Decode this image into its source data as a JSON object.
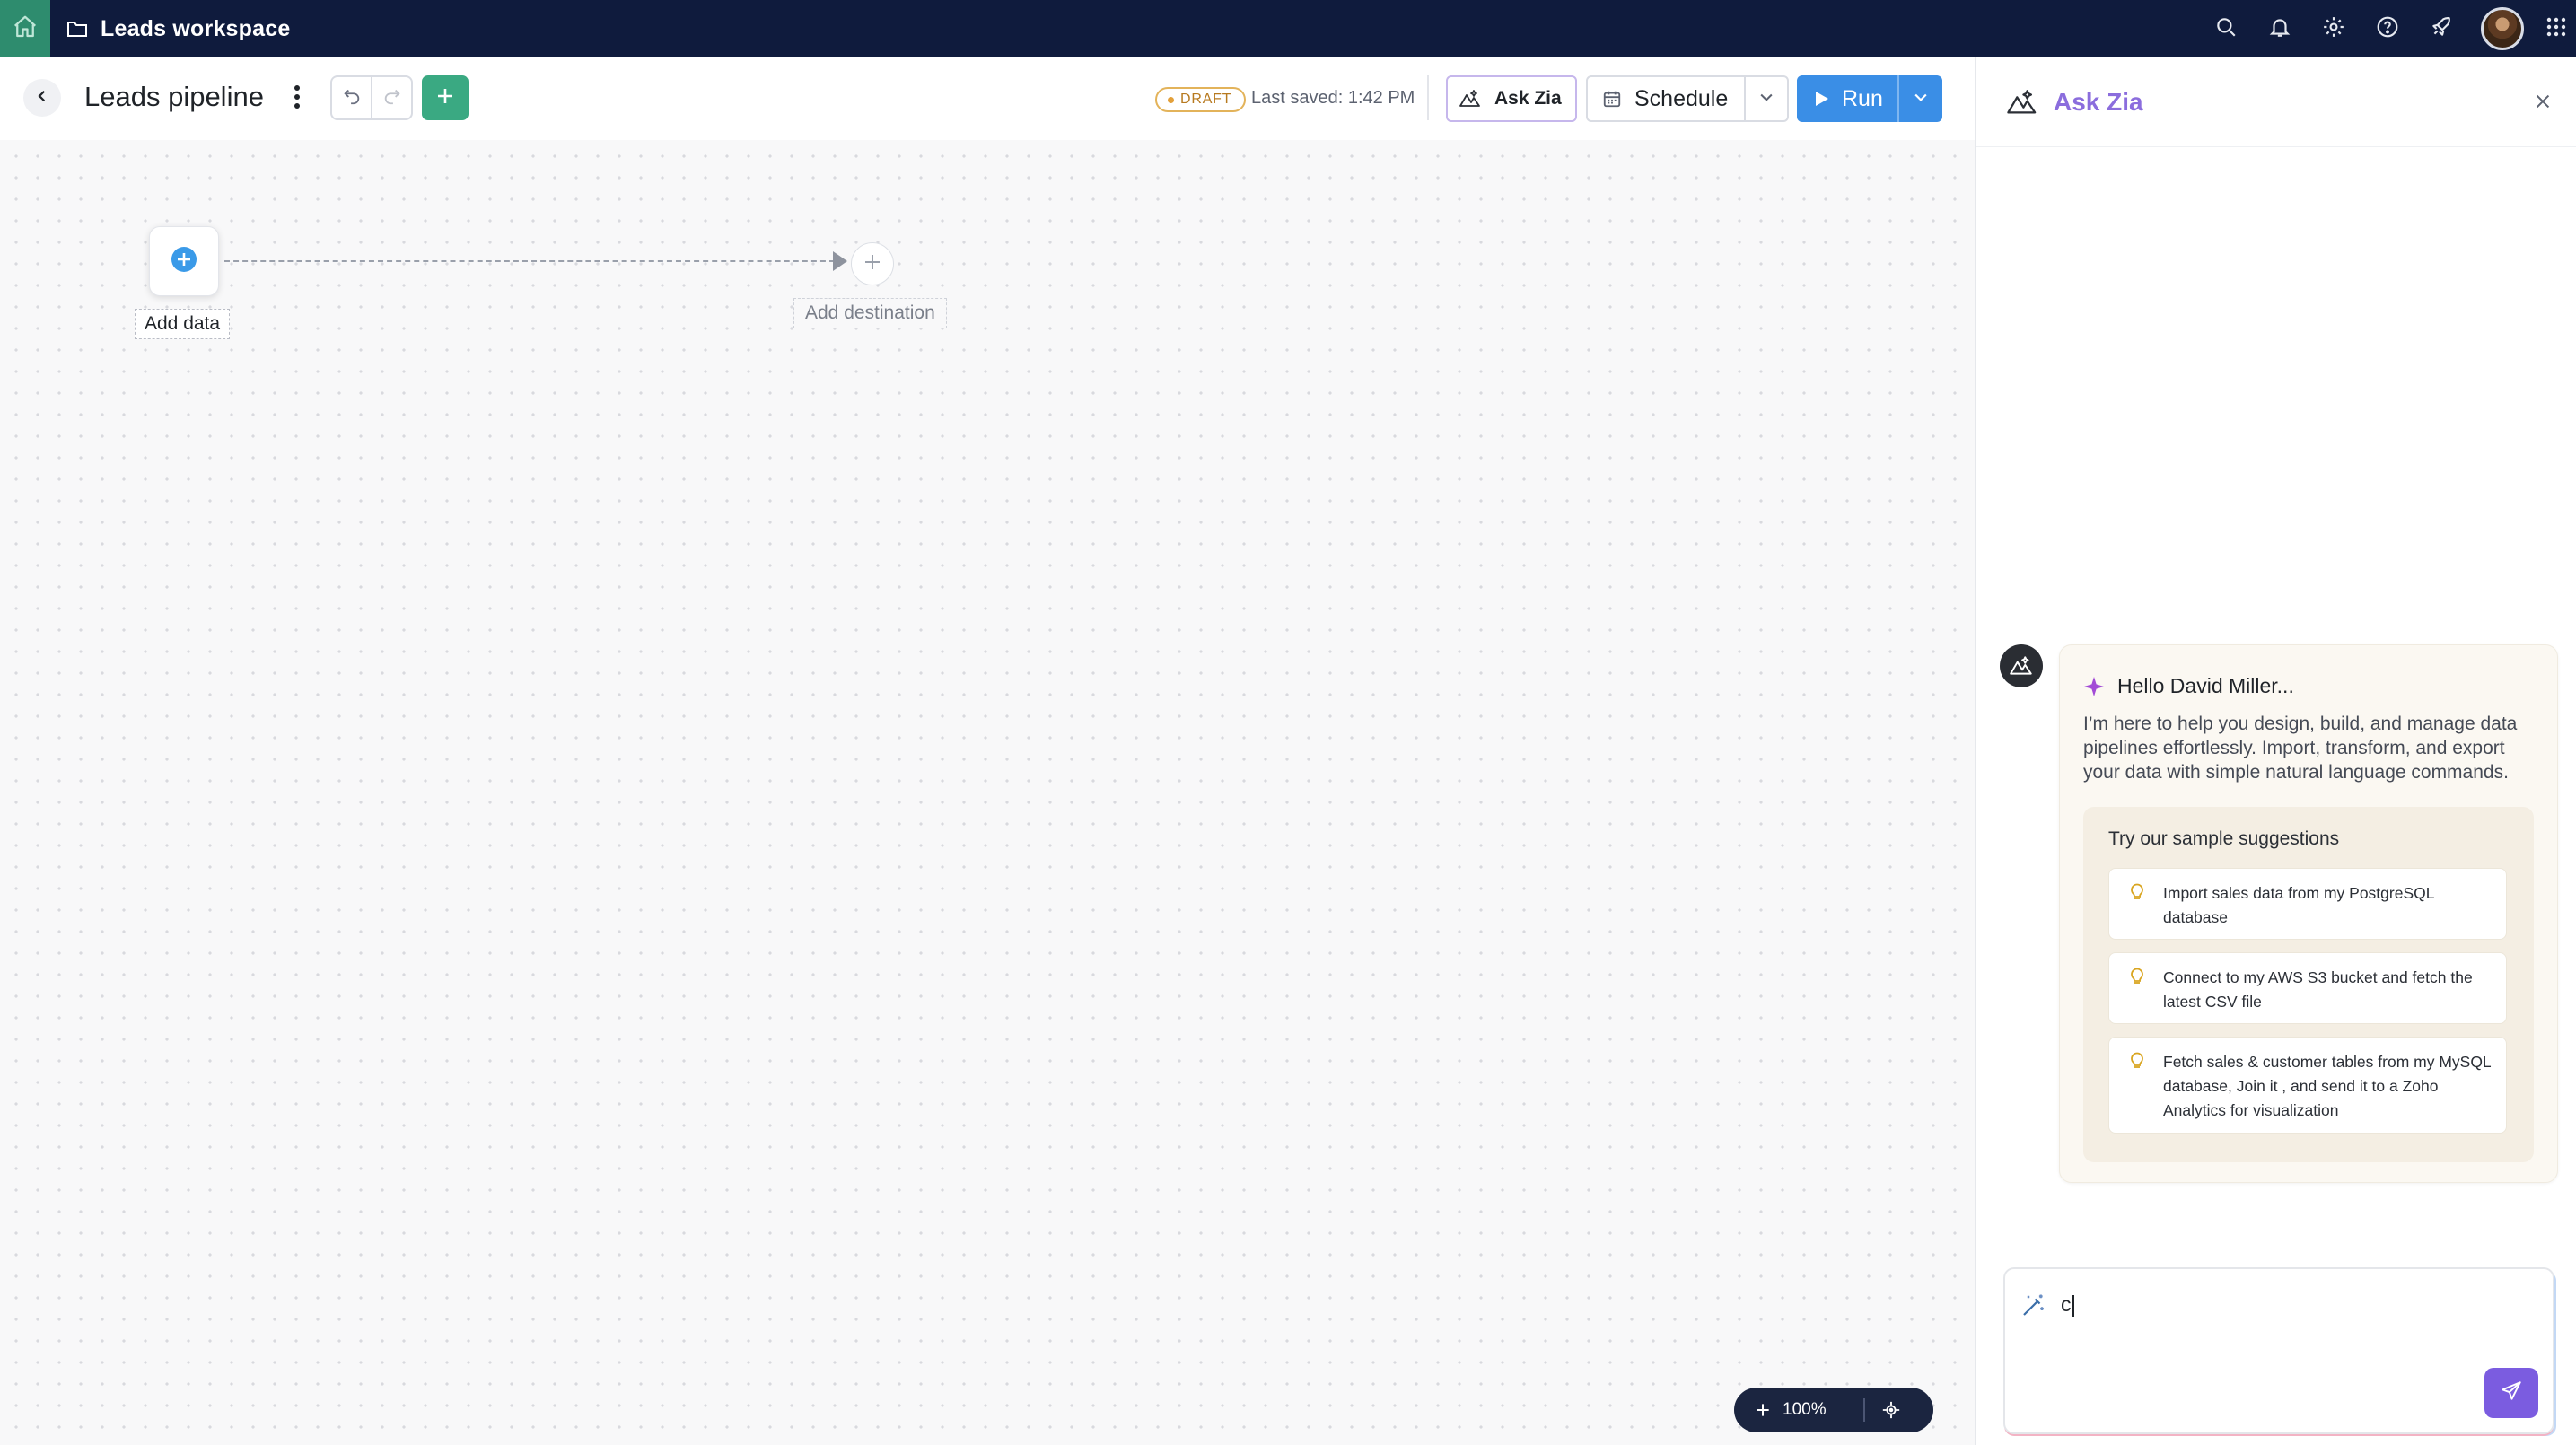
{
  "topbar": {
    "workspace_name": "Leads workspace",
    "icons": [
      "home-icon",
      "folder-icon",
      "search-icon",
      "bell-icon",
      "gear-icon",
      "help-icon",
      "rocket-icon",
      "avatar",
      "apps-grid-icon"
    ]
  },
  "toolbar": {
    "pipeline_title": "Leads pipeline",
    "draft_badge": "DRAFT",
    "last_saved": "Last saved: 1:42 PM",
    "ask_zia_label": "Ask Zia",
    "schedule_label": "Schedule",
    "run_label": "Run"
  },
  "canvas": {
    "source_label": "Add data",
    "destination_label": "Add destination",
    "zoom_level": "100%"
  },
  "zia": {
    "title": "Ask Zia",
    "greeting": "Hello David Miller...",
    "intro": "I’m here to help you design, build, and manage data pipelines effortlessly. Import, transform, and export your data with simple natural language commands.",
    "suggestions_title": "Try our sample suggestions",
    "suggestions": [
      "Import sales data from my PostgreSQL database",
      "Connect to my AWS S3 bucket and fetch the latest CSV file",
      "Fetch sales & customer tables from my MySQL database, Join it , and send it to a Zoho Analytics for visualization"
    ],
    "input_value": "c"
  },
  "colors": {
    "topbar_bg": "#0f1b3d",
    "home_accent": "#2e8c6e",
    "add_button": "#3aa982",
    "run_button": "#3a8ee6",
    "zia_accent": "#8b6ddd",
    "send_button": "#7b5ce0",
    "draft_badge": "#e3a03a"
  }
}
